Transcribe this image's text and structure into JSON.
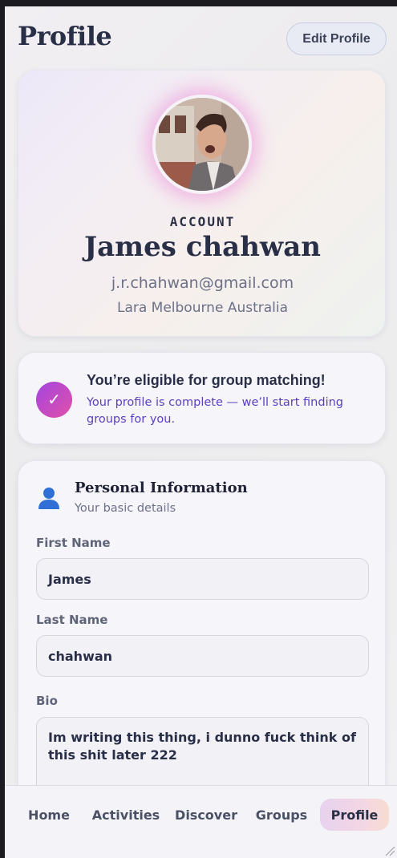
{
  "header": {
    "title": "Profile",
    "edit_label": "Edit Profile"
  },
  "account": {
    "label": "ACCOUNT",
    "name": "James chahwan",
    "email": "j.r.chahwan@gmail.com",
    "location": "Lara Melbourne Australia"
  },
  "eligibility": {
    "icon": "check-icon",
    "check_glyph": "✓",
    "title": "You’re eligible for group matching!",
    "text": "Your profile is complete — we’ll start finding groups for you."
  },
  "personal": {
    "icon": "person-icon",
    "title": "Personal Information",
    "subtitle": "Your basic details",
    "first_name_label": "First Name",
    "first_name_value": "James",
    "last_name_label": "Last Name",
    "last_name_value": "chahwan",
    "bio_label": "Bio",
    "bio_value": "Im writing this thing, i dunno fuck think of this shit later 222"
  },
  "nav": {
    "items": [
      {
        "label": "Home"
      },
      {
        "label": "Activities"
      },
      {
        "label": "Discover"
      },
      {
        "label": "Groups"
      },
      {
        "label": "Profile",
        "active": true
      }
    ]
  },
  "colors": {
    "accent_purple": "#a445e0",
    "accent_pink": "#e050a8",
    "eligibility_text": "#5a3fbf",
    "title_text": "#2a2f48"
  }
}
